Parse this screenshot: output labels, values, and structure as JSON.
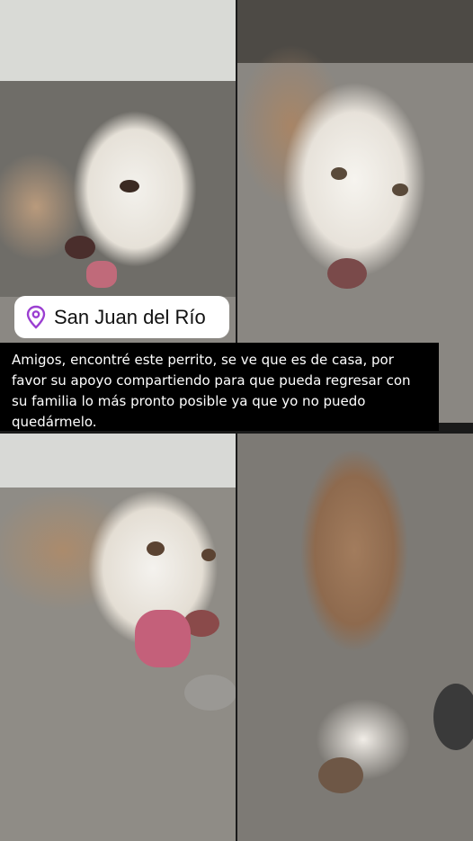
{
  "location_sticker": {
    "icon": "map-pin-icon",
    "icon_color": "#9b3fd1",
    "place": "San Juan del Río"
  },
  "caption": {
    "text": "Amigos, encontré este perrito, se ve que es de casa, por favor su apoyo compartiendo para que pueda regresar con su familia lo más pronto posible ya que yo no puedo quedármelo."
  }
}
